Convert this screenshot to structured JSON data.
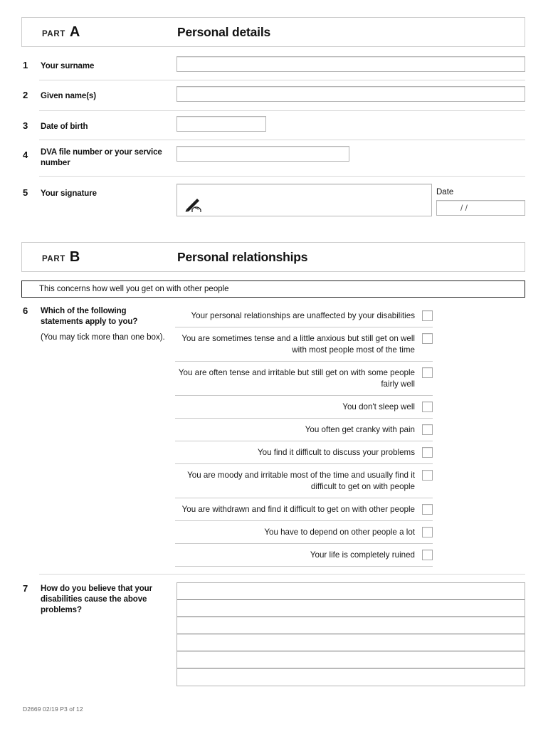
{
  "part_a": {
    "part_word": "PART",
    "part_letter": "A",
    "title": "Personal details",
    "questions": [
      {
        "num": "1",
        "label": "Your surname",
        "field_value": ""
      },
      {
        "num": "2",
        "label": "Given name(s)",
        "field_value": ""
      },
      {
        "num": "3",
        "label": "Date of birth",
        "field_value": ""
      },
      {
        "num": "4",
        "label": "DVA file number or your service number",
        "field_value": ""
      },
      {
        "num": "5",
        "label": "Your signature",
        "field_value": ""
      }
    ],
    "signature_icon": "hand-writing-pen-icon",
    "date_label": "Date",
    "date_value": "/          /"
  },
  "part_b": {
    "part_word": "PART",
    "part_letter": "B",
    "title": "Personal relationships",
    "concerns_note": "This concerns how well you get on with other people",
    "q6": {
      "num": "6",
      "label": "Which of the following statements apply to you?",
      "sublabel": "(You may tick more than one box).",
      "statements": [
        {
          "text": "Your personal relationships are unaffected by your disabilities",
          "checked": false
        },
        {
          "text": "You are sometimes tense and a little anxious but still get on well with most people most of the time",
          "checked": false
        },
        {
          "text": "You are often tense and irritable but still get on with some people fairly well",
          "checked": false
        },
        {
          "text": "You don't sleep well",
          "checked": false
        },
        {
          "text": "You often get cranky with pain",
          "checked": false
        },
        {
          "text": "You find it difficult to discuss your problems",
          "checked": false
        },
        {
          "text": "You are moody and irritable most of the time and usually find it difficult to get on with people",
          "checked": false
        },
        {
          "text": "You are withdrawn and find it difficult to get on with other people",
          "checked": false
        },
        {
          "text": "You have to depend on other people a lot",
          "checked": false
        },
        {
          "text": "Your life is completely ruined",
          "checked": false
        }
      ]
    },
    "q7": {
      "num": "7",
      "label": "How do you believe that your disabilities cause the above problems?",
      "line_count": 6,
      "value": ""
    }
  },
  "footer": {
    "text": "D2669 02/19 P3 of 12"
  },
  "colors": {
    "header_border": "#cccccc",
    "banner_border": "#222222",
    "field_border": "#b5b5b5",
    "separator": "#d8d8d8",
    "text": "#1a1a1a"
  }
}
